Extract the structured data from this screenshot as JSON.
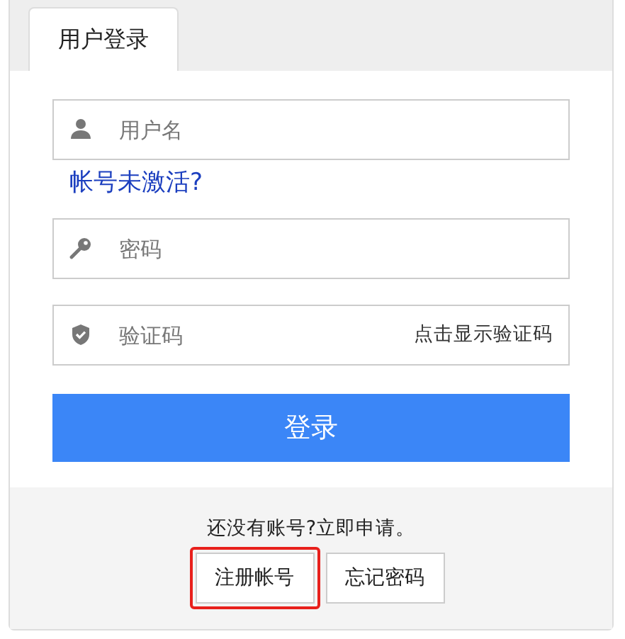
{
  "tabs": [
    {
      "label": "用户登录",
      "selected": true
    }
  ],
  "fields": [
    {
      "kind": "user",
      "placeholder": "用户名"
    },
    {
      "kind": "password",
      "placeholder": "密码"
    },
    {
      "kind": "captcha",
      "placeholder": "验证码",
      "action": "点击显示验证码"
    }
  ],
  "inactive_link": "帐号未激活?",
  "login_button": "登录",
  "footer": {
    "prompt": "还没有账号?立即申请。",
    "buttons": [
      {
        "label": "注册帐号",
        "highlighted": true
      },
      {
        "label": "忘记密码",
        "highlighted": false
      }
    ]
  }
}
